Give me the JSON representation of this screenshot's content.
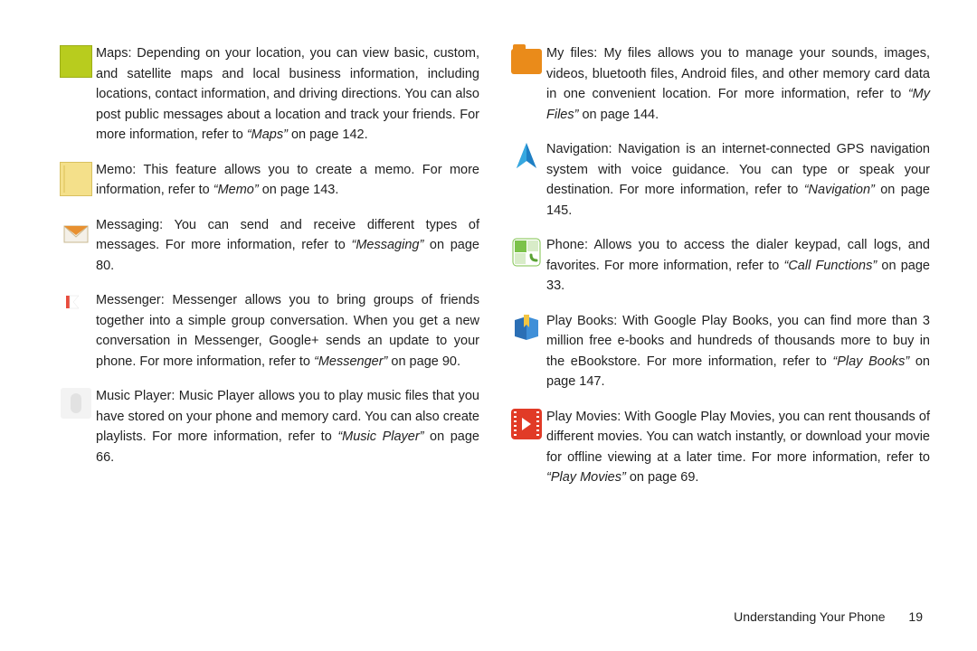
{
  "left": [
    {
      "icon": "maps",
      "label": "Maps",
      "body": ": Depending on your location, you can view basic, custom, and satellite maps and local business information, including locations, contact information, and driving directions. You can also post public messages about a location and track your friends. For more information, refer to ",
      "ref": "“Maps”",
      "tail": " on page 142."
    },
    {
      "icon": "memo",
      "label": "Memo",
      "body": ": This feature allows you to create a memo. For more information, refer to ",
      "ref": "“Memo”",
      "tail": " on page 143."
    },
    {
      "icon": "messaging",
      "label": "Messaging",
      "body": ": You can send and receive different types of messages. For more information, refer to ",
      "ref": "“Messaging”",
      "tail": " on page 80."
    },
    {
      "icon": "messenger",
      "label": "Messenger",
      "body": ": Messenger allows you to bring groups of friends together into a simple group conversation. When you get a new conversation in Messenger, Google+ sends an update to your phone. For more information, refer to ",
      "ref": "“Messenger”",
      "tail": " on page 90."
    },
    {
      "icon": "music",
      "label": "Music Player",
      "body": ": Music Player allows you to play music files that you have stored on your phone and memory card. You can also create playlists. For more information, refer to ",
      "ref": "“Music Player”",
      "tail": " on page 66."
    }
  ],
  "right": [
    {
      "icon": "files",
      "label": "My files",
      "body": ": My files allows you to manage your sounds, images, videos, bluetooth files, Android files, and other memory card data in one convenient location. For more information, refer to ",
      "ref": "“My Files”",
      "tail": " on page 144."
    },
    {
      "icon": "nav",
      "label": "Navigation",
      "body": ": Navigation is an internet-connected GPS navigation system with voice guidance. You can type or speak your destination. For more information, refer to ",
      "ref": "“Navigation”",
      "tail": " on page 145."
    },
    {
      "icon": "phone",
      "label": "Phone",
      "body": ": Allows you to access the dialer keypad, call logs, and favorites. For more information, refer to ",
      "ref": "“Call Functions”",
      "tail": " on page 33."
    },
    {
      "icon": "books",
      "label": "Play Books",
      "body": ": With Google Play Books, you can find more than 3 million free e-books and hundreds of thousands more to buy in the eBookstore. For more information, refer to ",
      "ref": "“Play Books”",
      "tail": " on page 147."
    },
    {
      "icon": "movies",
      "label": "Play Movies",
      "body": ": With Google Play Movies, you can rent thousands of different movies. You can watch instantly, or download your movie for offline viewing at a later time. For more information, refer to ",
      "ref": "“Play Movies”",
      "tail": " on page 69."
    }
  ],
  "footer": {
    "chapter": "Understanding Your Phone",
    "page": "19"
  }
}
